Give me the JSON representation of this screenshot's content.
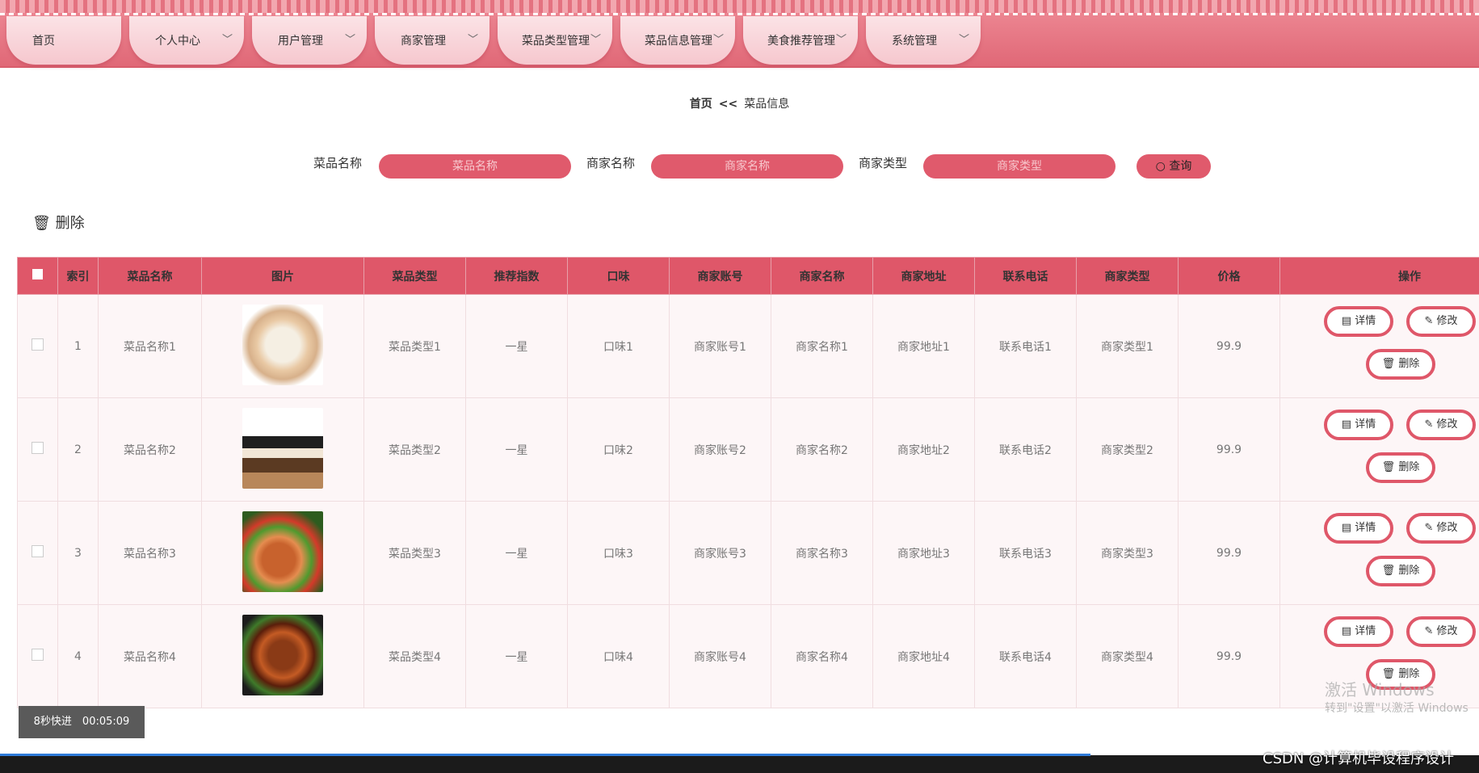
{
  "nav": [
    "首页",
    "个人中心",
    "用户管理",
    "商家管理",
    "菜品类型管理",
    "菜品信息管理",
    "美食推荐管理",
    "系统管理"
  ],
  "breadcrumb": {
    "home": "首页",
    "sep": "<<",
    "current": "菜品信息"
  },
  "search": {
    "dish_label": "菜品名称",
    "dish_placeholder": "菜品名称",
    "merchant_label": "商家名称",
    "merchant_placeholder": "商家名称",
    "type_label": "商家类型",
    "type_placeholder": "商家类型",
    "query_label": "查询"
  },
  "delete_label": "删除",
  "columns": [
    "索引",
    "菜品名称",
    "图片",
    "菜品类型",
    "推荐指数",
    "口味",
    "商家账号",
    "商家名称",
    "商家地址",
    "联系电话",
    "商家类型",
    "价格",
    "操作"
  ],
  "rows": [
    {
      "idx": "1",
      "name": "菜品名称1",
      "type": "菜品类型1",
      "rec": "一星",
      "taste": "口味1",
      "acct": "商家账号1",
      "mname": "商家名称1",
      "addr": "商家地址1",
      "phone": "联系电话1",
      "mtype": "商家类型1",
      "price": "99.9"
    },
    {
      "idx": "2",
      "name": "菜品名称2",
      "type": "菜品类型2",
      "rec": "一星",
      "taste": "口味2",
      "acct": "商家账号2",
      "mname": "商家名称2",
      "addr": "商家地址2",
      "phone": "联系电话2",
      "mtype": "商家类型2",
      "price": "99.9"
    },
    {
      "idx": "3",
      "name": "菜品名称3",
      "type": "菜品类型3",
      "rec": "一星",
      "taste": "口味3",
      "acct": "商家账号3",
      "mname": "商家名称3",
      "addr": "商家地址3",
      "phone": "联系电话3",
      "mtype": "商家类型3",
      "price": "99.9"
    },
    {
      "idx": "4",
      "name": "菜品名称4",
      "type": "菜品类型4",
      "rec": "一星",
      "taste": "口味4",
      "acct": "商家账号4",
      "mname": "商家名称4",
      "addr": "商家地址4",
      "phone": "联系电话4",
      "mtype": "商家类型4",
      "price": "99.9"
    }
  ],
  "ops": {
    "detail": "详情",
    "edit": "修改",
    "delete": "删除"
  },
  "toast": "8秒快进　00:05:09",
  "watermark": "激活 Windows",
  "watermark2": "转到\"设置\"以激活 Windows",
  "csdn": "CSDN @计算机毕设程序设计",
  "colors": {
    "accent": "#df5769",
    "nav": "#e06877"
  }
}
